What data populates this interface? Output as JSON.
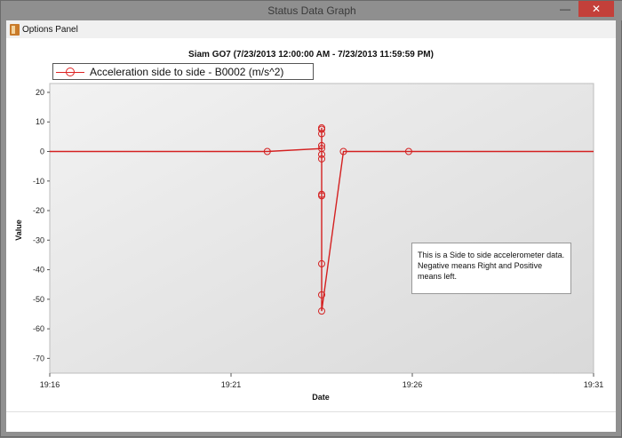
{
  "window": {
    "title": "Status Data Graph",
    "controls": {
      "minimize": "—",
      "maximize": "☐",
      "close": "✕"
    }
  },
  "menu": {
    "options_panel_label": "Options Panel"
  },
  "chart_data": {
    "type": "line",
    "title": "Siam GO7 (7/23/2013 12:00:00 AM - 7/23/2013 11:59:59 PM)",
    "xlabel": "Date",
    "ylabel": "Value",
    "legend": "top-left",
    "grid": false,
    "x_ticks": [
      "19:16",
      "19:21",
      "19:26",
      "19:31"
    ],
    "xlim": [
      "19:16",
      "19:31"
    ],
    "y_ticks": [
      20,
      10,
      0,
      -10,
      -20,
      -30,
      -40,
      -50,
      -60,
      -70
    ],
    "ylim": [
      -75,
      23
    ],
    "series": [
      {
        "name": "Acceleration side to side - B0002 (m/s^2)",
        "color": "#d42020",
        "points": [
          {
            "x": "19:16",
            "y": 0.0
          },
          {
            "x": "19:22",
            "y": 0.0
          },
          {
            "x": "19:23.5",
            "y": 1.0
          },
          {
            "x": "19:23.5",
            "y": 8.0
          },
          {
            "x": "19:23.5",
            "y": 7.5
          },
          {
            "x": "19:23.5",
            "y": 6.0
          },
          {
            "x": "19:23.5",
            "y": 2.0
          },
          {
            "x": "19:23.5",
            "y": -1.0
          },
          {
            "x": "19:23.5",
            "y": -2.5
          },
          {
            "x": "19:23.5",
            "y": -14.5
          },
          {
            "x": "19:23.5",
            "y": -15.0
          },
          {
            "x": "19:23.5",
            "y": -38.0
          },
          {
            "x": "19:23.5",
            "y": -48.5
          },
          {
            "x": "19:23.5",
            "y": -54.0
          },
          {
            "x": "19:24.1",
            "y": 0.0
          },
          {
            "x": "19:25.9",
            "y": 0.0
          },
          {
            "x": "19:31",
            "y": 0.0
          }
        ]
      }
    ],
    "annotation": "This is a Side to side accelerometer data. Negative means Right and Positive means left."
  }
}
